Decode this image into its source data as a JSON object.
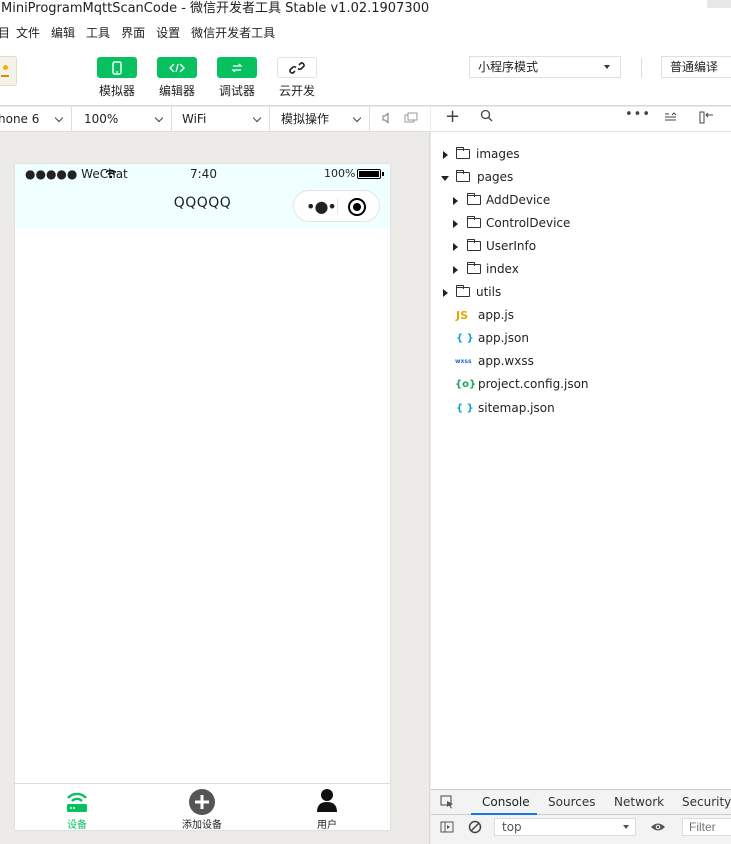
{
  "window": {
    "title": "MiniProgramMqttScanCode - 微信开发者工具 Stable v1.02.1907300"
  },
  "menu": [
    "目",
    "文件",
    "编辑",
    "工具",
    "界面",
    "设置",
    "微信开发者工具"
  ],
  "toolbar": {
    "tools": [
      {
        "label": "模拟器",
        "icon": "phone-icon"
      },
      {
        "label": "编辑器",
        "icon": "code-icon"
      },
      {
        "label": "调试器",
        "icon": "debug-icon"
      },
      {
        "label": "云开发",
        "icon": "cloud-link-icon"
      }
    ],
    "mode_select": "小程序模式",
    "compile_select": "普通编译"
  },
  "simulator_bar": {
    "device": "hone 6",
    "zoom": "100%",
    "network": "WiFi",
    "operation": "模拟操作"
  },
  "phone": {
    "status": {
      "signal": "●●●●● WeChat",
      "time": "7:40",
      "battery": "100%"
    },
    "nav_title": "QQQQQ",
    "tabs": [
      {
        "label": "设备",
        "icon": "router-icon",
        "active": true
      },
      {
        "label": "添加设备",
        "icon": "plus-circle-icon",
        "active": false
      },
      {
        "label": "用户",
        "icon": "user-icon",
        "active": false
      }
    ],
    "accent": "#07c160"
  },
  "filetree": {
    "items": [
      {
        "name": "images",
        "type": "folder",
        "expanded": false,
        "depth": 0
      },
      {
        "name": "pages",
        "type": "folder",
        "expanded": true,
        "depth": 0
      },
      {
        "name": "AddDevice",
        "type": "folder",
        "expanded": false,
        "depth": 1
      },
      {
        "name": "ControlDevice",
        "type": "folder",
        "expanded": false,
        "depth": 1
      },
      {
        "name": "UserInfo",
        "type": "folder",
        "expanded": false,
        "depth": 1
      },
      {
        "name": "index",
        "type": "folder",
        "expanded": false,
        "depth": 1
      },
      {
        "name": "utils",
        "type": "folder",
        "expanded": false,
        "depth": 0
      },
      {
        "name": "app.js",
        "type": "js",
        "badge": "JS",
        "depth": 0
      },
      {
        "name": "app.json",
        "type": "json",
        "badge": "{ }",
        "depth": 0
      },
      {
        "name": "app.wxss",
        "type": "wxss",
        "badge": "wxss",
        "depth": 0
      },
      {
        "name": "project.config.json",
        "type": "config",
        "badge": "{o}",
        "depth": 0
      },
      {
        "name": "sitemap.json",
        "type": "json",
        "badge": "{ }",
        "depth": 0
      }
    ]
  },
  "devtools": {
    "tabs": [
      "Console",
      "Sources",
      "Network",
      "Security"
    ],
    "active_tab": "Console",
    "context": "top",
    "filter_placeholder": "Filter"
  }
}
